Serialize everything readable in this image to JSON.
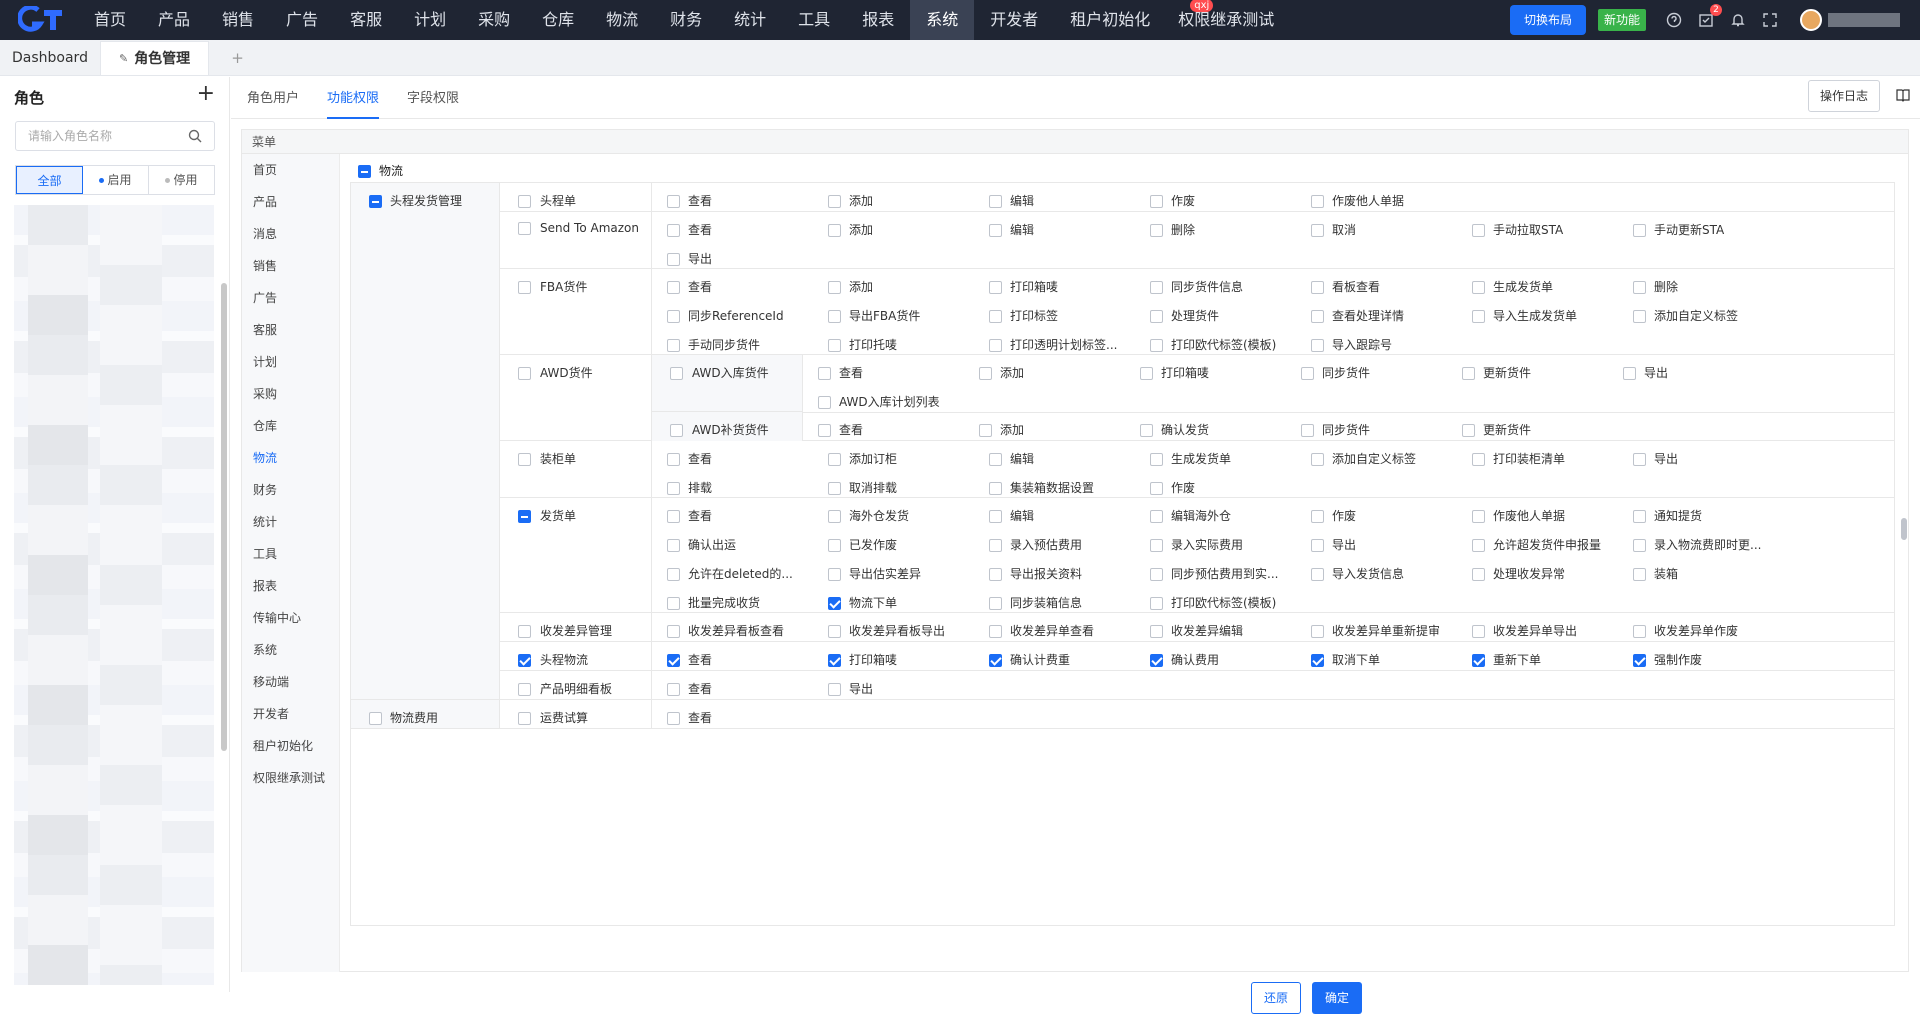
{
  "topnav": {
    "items": [
      "首页",
      "产品",
      "销售",
      "广告",
      "客服",
      "计划",
      "采购",
      "仓库",
      "物流",
      "财务",
      "统计",
      "工具",
      "报表",
      "系统",
      "开发者",
      "租户初始化",
      "权限继承测试"
    ],
    "active_index": 13,
    "badge": "qxj",
    "switch_label": "切换布局",
    "new_label": "新功能",
    "task_count": "2",
    "accent": "#1a6cf5"
  },
  "tabs": {
    "dashboard": "Dashboard",
    "role_mgmt": "角色管理"
  },
  "sidebar": {
    "title": "角色",
    "search_placeholder": "请输入角色名称",
    "filter_all": "全部",
    "filter_on": "启用",
    "filter_off": "停用"
  },
  "subtabs": [
    "角色用户",
    "功能权限",
    "字段权限"
  ],
  "log_label": "操作日志",
  "menu_header": "菜单",
  "menu": [
    "首页",
    "产品",
    "消息",
    "销售",
    "广告",
    "客服",
    "计划",
    "采购",
    "仓库",
    "物流",
    "财务",
    "统计",
    "工具",
    "报表",
    "传输中心",
    "系统",
    "移动端",
    "开发者",
    "租户初始化",
    "权限继承测试"
  ],
  "menu_active_index": 9,
  "section_title": "物流",
  "groups": [
    {
      "label": "头程发货管理",
      "state": "ind"
    },
    {
      "label": "物流费用",
      "state": "off"
    }
  ],
  "rows": [
    {
      "module": "头程单",
      "state": "off",
      "items": [
        [
          "查看",
          "off"
        ],
        [
          "添加",
          "off"
        ],
        [
          "编辑",
          "off"
        ],
        [
          "作废",
          "off"
        ],
        [
          "作废他人单据",
          "off"
        ]
      ]
    },
    {
      "module": "Send To Amazon",
      "state": "off",
      "items": [
        [
          "查看",
          "off"
        ],
        [
          "添加",
          "off"
        ],
        [
          "编辑",
          "off"
        ],
        [
          "删除",
          "off"
        ],
        [
          "取消",
          "off"
        ],
        [
          "手动拉取STA",
          "off"
        ],
        [
          "手动更新STA",
          "off"
        ],
        [
          "导出",
          "off"
        ]
      ]
    },
    {
      "module": "FBA货件",
      "state": "off",
      "items": [
        [
          "查看",
          "off"
        ],
        [
          "添加",
          "off"
        ],
        [
          "打印箱唛",
          "off"
        ],
        [
          "同步货件信息",
          "off"
        ],
        [
          "看板查看",
          "off"
        ],
        [
          "生成发货单",
          "off"
        ],
        [
          "删除",
          "off"
        ],
        [
          "同步ReferenceId",
          "off"
        ],
        [
          "导出FBA货件",
          "off"
        ],
        [
          "打印标签",
          "off"
        ],
        [
          "处理货件",
          "off"
        ],
        [
          "查看处理详情",
          "off"
        ],
        [
          "导入生成发货单",
          "off"
        ],
        [
          "添加自定义标签",
          "off"
        ],
        [
          "手动同步货件",
          "off"
        ],
        [
          "打印托唛",
          "off"
        ],
        [
          "打印透明计划标签...",
          "off"
        ],
        [
          "打印欧代标签(模板)",
          "off"
        ],
        [
          "导入跟踪号",
          "off"
        ]
      ]
    },
    {
      "module": "AWD货件",
      "state": "off",
      "subs": [
        {
          "label": "AWD入库货件",
          "items": [
            [
              "查看",
              "off"
            ],
            [
              "添加",
              "off"
            ],
            [
              "打印箱唛",
              "off"
            ],
            [
              "同步货件",
              "off"
            ],
            [
              "更新货件",
              "off"
            ],
            [
              "导出",
              "off"
            ],
            [
              "AWD入库计划列表",
              "off"
            ]
          ]
        },
        {
          "label": "AWD补货货件",
          "items": [
            [
              "查看",
              "off"
            ],
            [
              "添加",
              "off"
            ],
            [
              "确认发货",
              "off"
            ],
            [
              "同步货件",
              "off"
            ],
            [
              "更新货件",
              "off"
            ]
          ]
        }
      ]
    },
    {
      "module": "装柜单",
      "state": "off",
      "items": [
        [
          "查看",
          "off"
        ],
        [
          "添加订柜",
          "off"
        ],
        [
          "编辑",
          "off"
        ],
        [
          "生成发货单",
          "off"
        ],
        [
          "添加自定义标签",
          "off"
        ],
        [
          "打印装柜清单",
          "off"
        ],
        [
          "导出",
          "off"
        ],
        [
          "排载",
          "off"
        ],
        [
          "取消排载",
          "off"
        ],
        [
          "集装箱数据设置",
          "off"
        ],
        [
          "作废",
          "off"
        ]
      ]
    },
    {
      "module": "发货单",
      "state": "ind",
      "items": [
        [
          "查看",
          "off"
        ],
        [
          "海外仓发货",
          "off"
        ],
        [
          "编辑",
          "off"
        ],
        [
          "编辑海外仓",
          "off"
        ],
        [
          "作废",
          "off"
        ],
        [
          "作废他人单据",
          "off"
        ],
        [
          "通知提货",
          "off"
        ],
        [
          "确认出运",
          "off"
        ],
        [
          "已发作废",
          "off"
        ],
        [
          "录入预估费用",
          "off"
        ],
        [
          "录入实际费用",
          "off"
        ],
        [
          "导出",
          "off"
        ],
        [
          "允许超发货件申报量",
          "off"
        ],
        [
          "录入物流费即时更...",
          "off"
        ],
        [
          "允许在deleted的...",
          "off"
        ],
        [
          "导出估实差异",
          "off"
        ],
        [
          "导出报关资料",
          "off"
        ],
        [
          "同步预估费用到实...",
          "off"
        ],
        [
          "导入发货信息",
          "off"
        ],
        [
          "处理收发异常",
          "off"
        ],
        [
          "装箱",
          "off"
        ],
        [
          "批量完成收货",
          "off"
        ],
        [
          "物流下单",
          "chk"
        ],
        [
          "同步装箱信息",
          "off"
        ],
        [
          "打印欧代标签(模板)",
          "off"
        ]
      ]
    },
    {
      "module": "收发差异管理",
      "state": "off",
      "items": [
        [
          "收发差异看板查看",
          "off"
        ],
        [
          "收发差异看板导出",
          "off"
        ],
        [
          "收发差异单查看",
          "off"
        ],
        [
          "收发差异编辑",
          "off"
        ],
        [
          "收发差异单重新提审",
          "off"
        ],
        [
          "收发差异单导出",
          "off"
        ],
        [
          "收发差异单作废",
          "off"
        ]
      ]
    },
    {
      "module": "头程物流",
      "state": "chk",
      "items": [
        [
          "查看",
          "chk"
        ],
        [
          "打印箱唛",
          "chk"
        ],
        [
          "确认计费重",
          "chk"
        ],
        [
          "确认费用",
          "chk"
        ],
        [
          "取消下单",
          "chk"
        ],
        [
          "重新下单",
          "chk"
        ],
        [
          "强制作废",
          "chk"
        ]
      ]
    },
    {
      "module": "产品明细看板",
      "state": "off",
      "items": [
        [
          "查看",
          "off"
        ],
        [
          "导出",
          "off"
        ]
      ]
    },
    {
      "module": "运费试算",
      "state": "off",
      "items": [
        [
          "查看",
          "off"
        ]
      ]
    }
  ],
  "btn_reset": "还原",
  "btn_ok": "确定"
}
